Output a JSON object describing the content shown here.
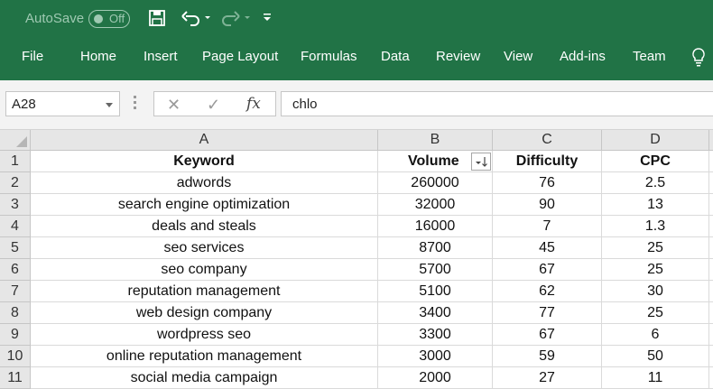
{
  "titlebar": {
    "autosave_label": "AutoSave",
    "autosave_state": "Off",
    "icons": [
      "save-icon",
      "undo-icon",
      "redo-icon",
      "customize-qat-icon"
    ]
  },
  "ribbon": {
    "tabs": [
      "File",
      "Home",
      "Insert",
      "Page Layout",
      "Formulas",
      "Data",
      "Review",
      "View",
      "Add-ins",
      "Team"
    ],
    "tell_me_icon": "lightbulb-icon"
  },
  "formula_bar": {
    "name_box": "A28",
    "cancel_icon": "✕",
    "enter_icon": "✓",
    "fx_label": "fx",
    "formula": "chlo"
  },
  "grid": {
    "columns": [
      "A",
      "B",
      "C",
      "D"
    ],
    "rows": [
      "1",
      "2",
      "3",
      "4",
      "5",
      "6",
      "7",
      "8",
      "9",
      "10",
      "11"
    ],
    "header_row": [
      "Keyword",
      "Volume",
      "Difficulty",
      "CPC"
    ],
    "data": [
      [
        "adwords",
        "260000",
        "76",
        "2.5"
      ],
      [
        "search engine optimization",
        "32000",
        "90",
        "13"
      ],
      [
        "deals and steals",
        "16000",
        "7",
        "1.3"
      ],
      [
        "seo services",
        "8700",
        "45",
        "25"
      ],
      [
        "seo company",
        "5700",
        "67",
        "25"
      ],
      [
        "reputation management",
        "5100",
        "62",
        "30"
      ],
      [
        "web design company",
        "3400",
        "77",
        "25"
      ],
      [
        "wordpress seo",
        "3300",
        "67",
        "6"
      ],
      [
        "online reputation management",
        "3000",
        "59",
        "50"
      ],
      [
        "social media campaign",
        "2000",
        "27",
        "11"
      ]
    ]
  },
  "colors": {
    "excel_green": "#217346",
    "header_gray": "#e6e6e6",
    "gridline": "#dadada"
  }
}
